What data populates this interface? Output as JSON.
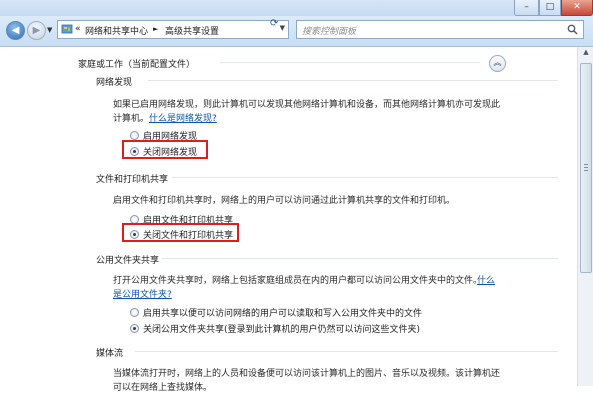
{
  "titlebar": {
    "minimize": "–",
    "maximize": "□",
    "close": "✕"
  },
  "nav": {
    "back_glyph": "◀",
    "forward_glyph": "▶",
    "history_glyph": "▼",
    "breadcrumb_sep1": "«",
    "breadcrumb_1": "网络和共享中心",
    "breadcrumb_sep2": "►",
    "breadcrumb_2": "高级共享设置",
    "dropdown_glyph": "▼",
    "refresh_glyph": "⟳",
    "search_placeholder": "搜索控制面板"
  },
  "profile": {
    "title": "家庭或工作（当前配置文件）",
    "collapse_glyph": "︽"
  },
  "network_discovery": {
    "heading": "网络发现",
    "desc_line1": "如果已启用网络发现，则此计算机可以发现其他网络计算机和设备，而其他网络计算机亦可发现此",
    "desc_line2": "计算机。",
    "link": "什么是网络发现?",
    "options": [
      {
        "label": "启用网络发现",
        "selected": false
      },
      {
        "label": "关闭网络发现",
        "selected": true
      }
    ]
  },
  "file_printer": {
    "heading": "文件和打印机共享",
    "desc": "启用文件和打印机共享时，网络上的用户可以访问通过此计算机共享的文件和打印机。",
    "options": [
      {
        "label": "启用文件和打印机共享",
        "selected": false
      },
      {
        "label": "关闭文件和打印机共享",
        "selected": true
      }
    ]
  },
  "public_folder": {
    "heading": "公用文件夹共享",
    "desc_line1": "打开公用文件夹共享时，网络上包括家庭组成员在内的用户都可以访问公用文件夹中的文件。",
    "link_part1": "什么",
    "link_part2": "是公用文件夹?",
    "options": [
      {
        "label": "启用共享以便可以访问网络的用户可以读取和写入公用文件夹中的文件",
        "selected": false
      },
      {
        "label": "关闭公用文件夹共享(登录到此计算机的用户仍然可以访问这些文件夹)",
        "selected": true
      }
    ]
  },
  "media": {
    "heading": "媒体流",
    "desc_line1": "当媒体流打开时，网络上的人员和设备便可以访问该计算机上的图片、音乐以及视频。该计算机还",
    "desc_line2": "可以在网络上查找媒体。"
  },
  "scrollbar": {
    "up_glyph": "▲"
  },
  "colors": {
    "highlight_box": "#e01d1d",
    "link": "#0a57b0"
  }
}
